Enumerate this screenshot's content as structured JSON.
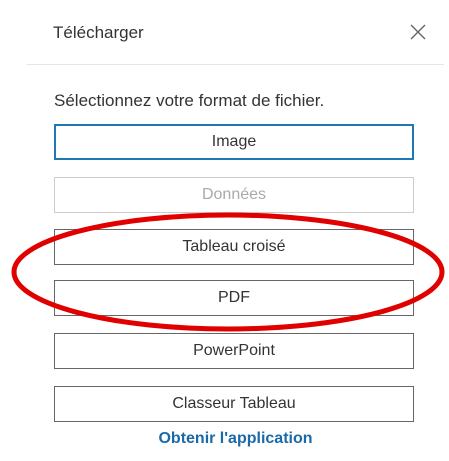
{
  "dialog": {
    "title": "Télécharger",
    "close_icon": "close-icon",
    "prompt": "Sélectionnez votre format de fichier.",
    "buttons": [
      {
        "label": "Image",
        "state": "selected"
      },
      {
        "label": "Données",
        "state": "disabled"
      },
      {
        "label": "Tableau croisé",
        "state": "normal"
      },
      {
        "label": "PDF",
        "state": "normal"
      },
      {
        "label": "PowerPoint",
        "state": "normal"
      },
      {
        "label": "Classeur Tableau",
        "state": "normal"
      }
    ],
    "app_link": "Obtenir l'application"
  },
  "colors": {
    "selected_border": "#1f77b4",
    "link": "#1a6aa8",
    "annotation": "#e00000"
  }
}
